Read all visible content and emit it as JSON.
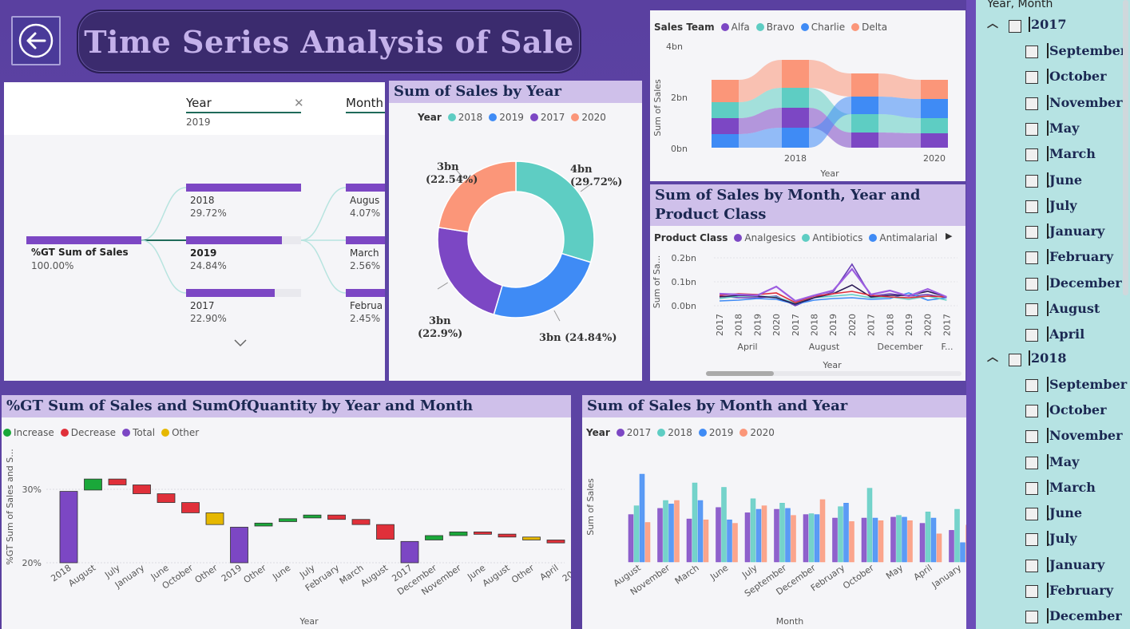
{
  "header": {
    "title": "Time Series Analysis of Sale"
  },
  "decomp": {
    "col1": "Year",
    "col1_value": "2019",
    "col2": "Month",
    "root_label": "%GT Sum of Sales",
    "root_pct": "100.00%",
    "years": [
      {
        "label": "2018",
        "pct": "29.72%",
        "frac": 0.2972
      },
      {
        "label": "2019",
        "pct": "24.84%",
        "frac": 0.2484
      },
      {
        "label": "2017",
        "pct": "22.90%",
        "frac": 0.229
      }
    ],
    "months": [
      {
        "label": "Augus",
        "pct": "4.07%"
      },
      {
        "label": "March",
        "pct": "2.56%"
      },
      {
        "label": "Februa",
        "pct": "2.45%"
      }
    ]
  },
  "donut": {
    "title": "Sum of Sales by Year",
    "legend_title": "Year",
    "chart_data": {
      "type": "pie",
      "categories": [
        "2018",
        "2019",
        "2017",
        "2020"
      ],
      "values": [
        29.72,
        24.84,
        22.9,
        22.54
      ],
      "labels": [
        "4bn",
        "3bn",
        "3bn",
        "3bn"
      ],
      "pct_labels": [
        "(29.72%)",
        "(24.84%)",
        "(22.9%)",
        "(22.54%)"
      ],
      "colors": [
        "#5ecdc3",
        "#3f8bf5",
        "#7c47c4",
        "#fb9679"
      ]
    }
  },
  "ribbon": {
    "legend_title": "Sales Team",
    "series_names": [
      "Alfa",
      "Bravo",
      "Charlie",
      "Delta"
    ],
    "series_colors": [
      "#7c47c4",
      "#5ecdc3",
      "#3f8bf5",
      "#fb9679"
    ],
    "ylabel": "Sum of Sales",
    "xlabel": "Year",
    "yticks": [
      "4bn",
      "2bn",
      "0bn"
    ],
    "xticks": [
      "2018",
      "2020"
    ]
  },
  "line": {
    "title": "Sum of Sales by Month, Year and Product Class",
    "legend_title": "Product Class",
    "series_names": [
      "Analgesics",
      "Antibiotics",
      "Antimalarial"
    ],
    "series_colors": [
      "#7c47c4",
      "#5ecdc3",
      "#3f8bf5"
    ],
    "ylabel": "Sum of Sa...",
    "xlabel": "Year",
    "yticks": [
      "0.2bn",
      "0.1bn",
      "0.0bn"
    ],
    "xticks": [
      "2017",
      "2018",
      "2019",
      "2020",
      "2017",
      "2018",
      "2019",
      "2020",
      "2017",
      "2018",
      "2019",
      "2020",
      "2017"
    ],
    "groups": [
      "April",
      "August",
      "December",
      "F..."
    ]
  },
  "waterfall": {
    "title": "%GT Sum of Sales and SumOfQuantity by Year and Month",
    "legend": [
      "Increase",
      "Decrease",
      "Total",
      "Other"
    ],
    "legend_colors": [
      "#1aa83a",
      "#e0303a",
      "#7c47c4",
      "#e6b800"
    ],
    "ylabel": "%GT Sum of Sales and S...",
    "xlabel": "Year",
    "yticks": [
      "30%",
      "20%"
    ],
    "chart_data": {
      "type": "bar",
      "categories": [
        "2018",
        "August",
        "July",
        "January",
        "June",
        "October",
        "Other",
        "2019",
        "Other",
        "June",
        "July",
        "February",
        "March",
        "August",
        "2017",
        "December",
        "November",
        "June",
        "August",
        "Other",
        "April",
        "2020"
      ],
      "bars": [
        {
          "t": "total",
          "s": 20,
          "e": 29.72
        },
        {
          "t": "inc",
          "s": 29.9,
          "e": 31.4
        },
        {
          "t": "dec",
          "s": 31.4,
          "e": 30.6
        },
        {
          "t": "dec",
          "s": 30.6,
          "e": 29.4
        },
        {
          "t": "dec",
          "s": 29.4,
          "e": 28.2
        },
        {
          "t": "dec",
          "s": 28.2,
          "e": 26.8
        },
        {
          "t": "oth",
          "s": 26.8,
          "e": 25.2
        },
        {
          "t": "total",
          "s": 20,
          "e": 24.84
        },
        {
          "t": "inc",
          "s": 25,
          "e": 25.4
        },
        {
          "t": "inc",
          "s": 25.6,
          "e": 26
        },
        {
          "t": "inc",
          "s": 26.1,
          "e": 26.5
        },
        {
          "t": "dec",
          "s": 26.5,
          "e": 25.9
        },
        {
          "t": "dec",
          "s": 25.9,
          "e": 25.2
        },
        {
          "t": "dec",
          "s": 25.2,
          "e": 23.2
        },
        {
          "t": "total",
          "s": 20,
          "e": 22.9
        },
        {
          "t": "inc",
          "s": 23.1,
          "e": 23.7
        },
        {
          "t": "inc",
          "s": 23.7,
          "e": 24.2
        },
        {
          "t": "dec",
          "s": 24.2,
          "e": 23.9
        },
        {
          "t": "dec",
          "s": 23.9,
          "e": 23.5
        },
        {
          "t": "oth",
          "s": 23.5,
          "e": 23.1
        },
        {
          "t": "dec",
          "s": 23.1,
          "e": 22.7
        },
        {
          "t": "total",
          "s": 20,
          "e": 22.54
        }
      ],
      "ylim": [
        20,
        32
      ]
    }
  },
  "clustered": {
    "title": "Sum of Sales by Month and Year",
    "legend_title": "Year",
    "series_names": [
      "2017",
      "2018",
      "2019",
      "2020"
    ],
    "series_colors": [
      "#7c47c4",
      "#5ecdc3",
      "#3f8bf5",
      "#fb9679"
    ],
    "ylabel": "Sum of Sales",
    "xlabel": "Month",
    "chart_data": {
      "type": "bar",
      "categories": [
        "August",
        "November",
        "March",
        "June",
        "July",
        "September",
        "December",
        "February",
        "October",
        "May",
        "April",
        "January"
      ],
      "series": [
        {
          "name": "2017",
          "values": [
            0.54,
            0.61,
            0.49,
            0.62,
            0.56,
            0.6,
            0.54,
            0.5,
            0.5,
            0.51,
            0.44,
            0.36
          ]
        },
        {
          "name": "2018",
          "values": [
            0.64,
            0.7,
            0.9,
            0.85,
            0.72,
            0.67,
            0.55,
            0.63,
            0.84,
            0.53,
            0.57,
            0.6
          ]
        },
        {
          "name": "2019",
          "values": [
            1.0,
            0.66,
            0.7,
            0.48,
            0.6,
            0.61,
            0.54,
            0.67,
            0.5,
            0.51,
            0.5,
            0.22
          ]
        },
        {
          "name": "2020",
          "values": [
            0.45,
            0.7,
            0.48,
            0.44,
            0.64,
            0.53,
            0.71,
            0.46,
            0.47,
            0.47,
            0.32,
            0.42
          ]
        }
      ]
    }
  },
  "slicer": {
    "title": "Year, Month",
    "groups": [
      {
        "year": "2017",
        "months": [
          "September",
          "October",
          "November",
          "May",
          "March",
          "June",
          "July",
          "January",
          "February",
          "December",
          "August",
          "April"
        ]
      },
      {
        "year": "2018",
        "months": [
          "September",
          "October",
          "November",
          "May",
          "March",
          "June",
          "July",
          "January",
          "February",
          "December"
        ]
      }
    ]
  }
}
